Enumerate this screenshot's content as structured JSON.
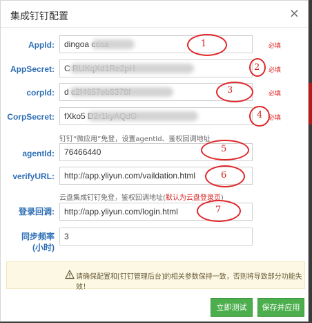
{
  "dialog": {
    "title": "集成钉钉配置",
    "close_icon": "×"
  },
  "fields": [
    {
      "label": "AppId:",
      "value": "dingoa                    cosa",
      "required": "必填"
    },
    {
      "label": "AppSecret:",
      "value": "C                              RUXqXd1Re2pH",
      "required": "必填"
    },
    {
      "label": "corpId:",
      "value": "d                                    c2f4657eb6378f",
      "required": "必填"
    },
    {
      "label": "CorpSecret:",
      "value": "fXko5                                  D2r1kyAQdG",
      "required": "必填"
    },
    {
      "label": "agentId:",
      "value": "76466440"
    },
    {
      "label": "verifyURL:",
      "value": "http://app.yliyun.com/vaildation.html"
    },
    {
      "label": "登录回调:",
      "value": "http://app.yliyun.com/login.html"
    },
    {
      "label": "同步频率\n(小时)",
      "label_line1": "同步频率",
      "label_line2": "(小时)",
      "value": "3"
    }
  ],
  "hints": {
    "agent": "钉钉“微应用”免登，设置agentId、鉴权回调地址",
    "login_prefix": "云盘集成钉钉免登，鉴权回调地址(",
    "login_link": "默认为云盘登录页",
    "login_suffix": ")"
  },
  "annotations": [
    "1",
    "2",
    "3",
    "4",
    "5",
    "6",
    "7"
  ],
  "warning": {
    "icon": "warning-icon",
    "text": "请确保配置和[钉钉管理后台]的相关参数保持一致，否则将导致部分功能失效！"
  },
  "buttons": {
    "test": "立即测试",
    "save": "保存并应用"
  },
  "colors": {
    "label": "#2f6fb6",
    "required": "#e02020",
    "button": "#4cae4c",
    "annotation": "#e0272a"
  }
}
